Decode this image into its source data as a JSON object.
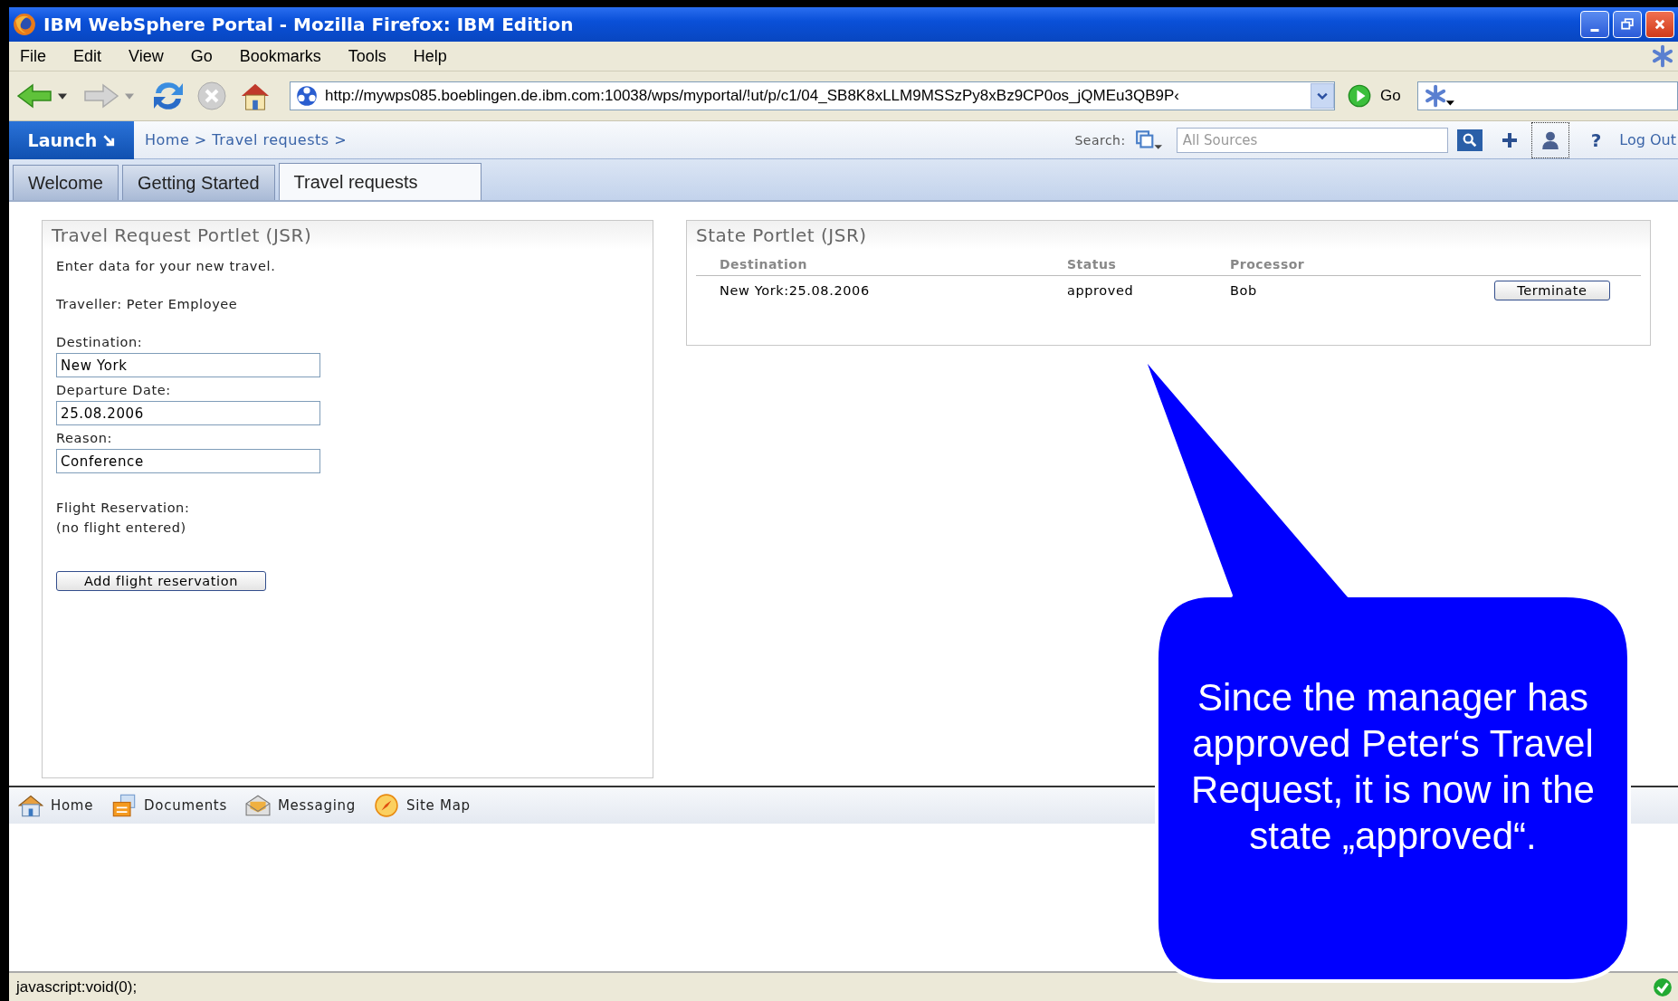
{
  "window": {
    "title": "IBM WebSphere Portal - Mozilla Firefox: IBM Edition"
  },
  "menu": [
    "File",
    "Edit",
    "View",
    "Go",
    "Bookmarks",
    "Tools",
    "Help"
  ],
  "toolbar": {
    "address": "http://mywps085.boeblingen.de.ibm.com:10038/wps/myportal/!ut/p/c1/04_SB8K8xLLM9MSSzPy8xBz9CP0os_jQMEu3QB9P‹",
    "go": "Go"
  },
  "portal_header": {
    "launch": "Launch",
    "breadcrumb": "Home > Travel requests >",
    "search_label": "Search:",
    "search_placeholder": "All Sources",
    "help": "?",
    "logout": "Log Out"
  },
  "tabs": [
    {
      "label": "Welcome",
      "selected": false
    },
    {
      "label": "Getting Started",
      "selected": false
    },
    {
      "label": "Travel requests",
      "selected": true
    }
  ],
  "travel_portlet": {
    "title": "Travel Request Portlet (JSR)",
    "intro": "Enter data for your new travel.",
    "traveller": "Traveller: Peter Employee",
    "fields": [
      {
        "label": "Destination:",
        "value": "New York"
      },
      {
        "label": "Departure Date:",
        "value": "25.08.2006"
      },
      {
        "label": "Reason:",
        "value": "Conference"
      }
    ],
    "flight_label": "Flight Reservation:",
    "flight_value": "(no flight entered)",
    "button": "Add flight reservation"
  },
  "state_portlet": {
    "title": "State Portlet (JSR)",
    "columns": [
      "Destination",
      "Status",
      "Processor"
    ],
    "rows": [
      {
        "cells": [
          "New York:25.08.2006",
          "approved",
          "Bob"
        ],
        "button": "Terminate"
      }
    ]
  },
  "footer_links": [
    {
      "label": "Home",
      "kind": "home"
    },
    {
      "label": "Documents",
      "kind": "documents"
    },
    {
      "label": "Messaging",
      "kind": "messaging"
    },
    {
      "label": "Site Map",
      "kind": "sitemap"
    }
  ],
  "status_bar": {
    "text": "javascript:void(0);"
  },
  "callout": {
    "text": "Since the manager has approved Peter‘s Travel Request, it is now in the state „approved“."
  }
}
